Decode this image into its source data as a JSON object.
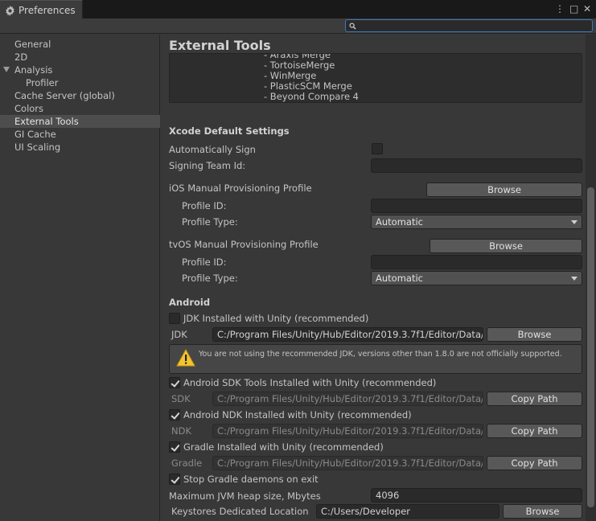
{
  "window": {
    "tab_title": "Preferences",
    "menu_glyph": "⋮",
    "maximize_glyph": "□",
    "close_glyph": "✕"
  },
  "search": {
    "placeholder": "",
    "value": ""
  },
  "sidebar": {
    "items": [
      {
        "label": "General"
      },
      {
        "label": "2D"
      },
      {
        "label": "Analysis"
      },
      {
        "label": "Profiler"
      },
      {
        "label": "Cache Server (global)"
      },
      {
        "label": "Colors"
      },
      {
        "label": "External Tools"
      },
      {
        "label": "GI Cache"
      },
      {
        "label": "UI Scaling"
      }
    ],
    "selected": "External Tools"
  },
  "page": {
    "title": "External Tools"
  },
  "diff_tools": [
    "- Araxis Merge",
    "- TortoiseMerge",
    "- WinMerge",
    "- PlasticSCM Merge",
    "- Beyond Compare 4"
  ],
  "xcode": {
    "header": "Xcode Default Settings",
    "auto_sign_label": "Automatically Sign",
    "auto_sign_checked": false,
    "team_id_label": "Signing Team Id:",
    "team_id_value": "",
    "ios": {
      "label": "iOS Manual Provisioning Profile",
      "browse": "Browse",
      "profile_id_label": "Profile ID:",
      "profile_id_value": "",
      "profile_type_label": "Profile Type:",
      "profile_type_value": "Automatic"
    },
    "tvos": {
      "label": "tvOS Manual Provisioning Profile",
      "browse": "Browse",
      "profile_id_label": "Profile ID:",
      "profile_id_value": "",
      "profile_type_label": "Profile Type:",
      "profile_type_value": "Automatic"
    }
  },
  "android": {
    "header": "Android",
    "jdk_checkbox_label": "JDK Installed with Unity (recommended)",
    "jdk_checked": false,
    "jdk_label": "JDK",
    "jdk_path": "C:/Program Files/Unity/Hub/Editor/2019.3.7f1/Editor/Data/",
    "jdk_browse": "Browse",
    "warning_text": "You are not using the recommended JDK, versions other than 1.8.0 are not officially supported.",
    "sdk_checkbox_label": "Android SDK Tools Installed with Unity (recommended)",
    "sdk_checked": true,
    "sdk_label": "SDK",
    "sdk_path": "C:/Program Files/Unity/Hub/Editor/2019.3.7f1/Editor/Data/",
    "sdk_copy": "Copy Path",
    "ndk_checkbox_label": "Android NDK Installed with Unity (recommended)",
    "ndk_checked": true,
    "ndk_label": "NDK",
    "ndk_path": "C:/Program Files/Unity/Hub/Editor/2019.3.7f1/Editor/Data/",
    "ndk_copy": "Copy Path",
    "gradle_checkbox_label": "Gradle Installed with Unity (recommended)",
    "gradle_checked": true,
    "gradle_label": "Gradle",
    "gradle_path": "C:/Program Files/Unity/Hub/Editor/2019.3.7f1/Editor/Data/",
    "gradle_copy": "Copy Path",
    "stop_gradle_label": "Stop Gradle daemons on exit",
    "stop_gradle_checked": true,
    "heap_label": "Maximum JVM heap size, Mbytes",
    "heap_value": "4096",
    "keystore_label": "Keystores Dedicated Location",
    "keystore_value": "C:/Users/Developer",
    "keystore_browse": "Browse"
  },
  "colors": {
    "accent": "#3a79bb",
    "warning": "#f4c430",
    "background": "#383838"
  }
}
